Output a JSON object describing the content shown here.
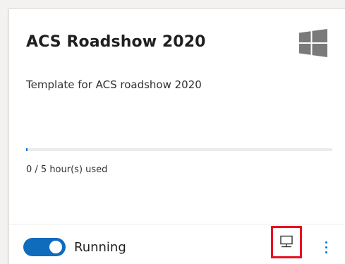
{
  "lab": {
    "title": "ACS Roadshow 2020",
    "os_icon": "windows-logo-icon",
    "description": "Template for ACS roadshow 2020"
  },
  "usage": {
    "text": "0 / 5 hour(s) used",
    "used_hours": 0,
    "total_hours": 5
  },
  "footer": {
    "status_label": "Running",
    "toggle_on": true,
    "connect_icon": "monitor-icon",
    "more_icon": "more-vertical-icon"
  },
  "colors": {
    "accent": "#0078d4",
    "toggle": "#0f6cbd",
    "highlight": "#e81123",
    "windows_logo": "#7a7a7a"
  }
}
